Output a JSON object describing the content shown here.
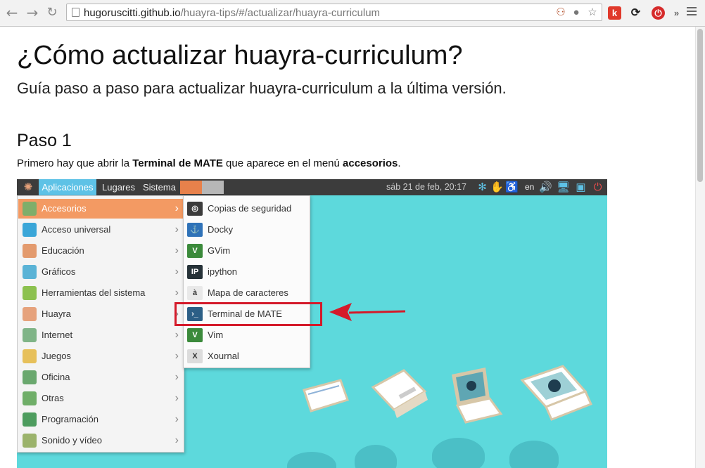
{
  "browser": {
    "url_host": "hugoruscitti.github.io",
    "url_path": "/huayra-tips/#/actualizar/huayra-curriculum",
    "extensions": [
      "k",
      "»"
    ]
  },
  "page": {
    "title": "¿Cómo actualizar huayra-curriculum?",
    "subtitle": "Guía paso a paso para actualizar huayra-curriculum a la última versión.",
    "step_title": "Paso 1",
    "paragraph": {
      "before": "Primero hay que abrir la ",
      "bold1": "Terminal de MATE",
      "middle": " que aparece en el menú ",
      "bold2": "accesorios",
      "after": "."
    }
  },
  "desktop": {
    "panel": {
      "applications": "Aplicaciones",
      "places": "Lugares",
      "system": "Sistema",
      "clock": "sáb 21 de feb, 20:17",
      "language": "en"
    },
    "menu": [
      {
        "label": "Accesorios",
        "icon": "accessories-icon",
        "color": "#7fae6a",
        "active": true
      },
      {
        "label": "Acceso universal",
        "icon": "universal-access-icon",
        "color": "#3aa6d8"
      },
      {
        "label": "Educación",
        "icon": "education-icon",
        "color": "#e39a6d"
      },
      {
        "label": "Gráficos",
        "icon": "graphics-icon",
        "color": "#5ab3d6"
      },
      {
        "label": "Herramientas del sistema",
        "icon": "system-tools-icon",
        "color": "#8cc14f"
      },
      {
        "label": "Huayra",
        "icon": "huayra-icon",
        "color": "#e6a27c"
      },
      {
        "label": "Internet",
        "icon": "internet-icon",
        "color": "#7fb487"
      },
      {
        "label": "Juegos",
        "icon": "games-icon",
        "color": "#e7c05a"
      },
      {
        "label": "Oficina",
        "icon": "office-icon",
        "color": "#6aa86e"
      },
      {
        "label": "Otras",
        "icon": "other-icon",
        "color": "#6fae68"
      },
      {
        "label": "Programación",
        "icon": "programming-icon",
        "color": "#4d9c5e"
      },
      {
        "label": "Sonido y vídeo",
        "icon": "sound-video-icon",
        "color": "#9bb36b"
      }
    ],
    "submenu": [
      {
        "label": "Copias de seguridad",
        "icon": "backup-icon",
        "glyph": "◎",
        "color": "#3b3b3b"
      },
      {
        "label": "Docky",
        "icon": "docky-icon",
        "glyph": "⚓",
        "color": "#2f72b8"
      },
      {
        "label": "GVim",
        "icon": "gvim-icon",
        "glyph": "V",
        "color": "#3b8a3b"
      },
      {
        "label": "ipython",
        "icon": "ipython-icon",
        "glyph": "IP",
        "color": "#263238"
      },
      {
        "label": "Mapa de caracteres",
        "icon": "character-map-icon",
        "glyph": "à",
        "color": "#e9e9e9"
      },
      {
        "label": "Terminal de MATE",
        "icon": "terminal-icon",
        "glyph": "›_",
        "color": "#2c5f86"
      },
      {
        "label": "Vim",
        "icon": "vim-icon",
        "glyph": "V",
        "color": "#3b8a3b"
      },
      {
        "label": "Xournal",
        "icon": "xournal-icon",
        "glyph": "X",
        "color": "#dcdcdc"
      }
    ],
    "highlight_color": "#d41a2a",
    "desktop_color": "#5dd9dc"
  }
}
